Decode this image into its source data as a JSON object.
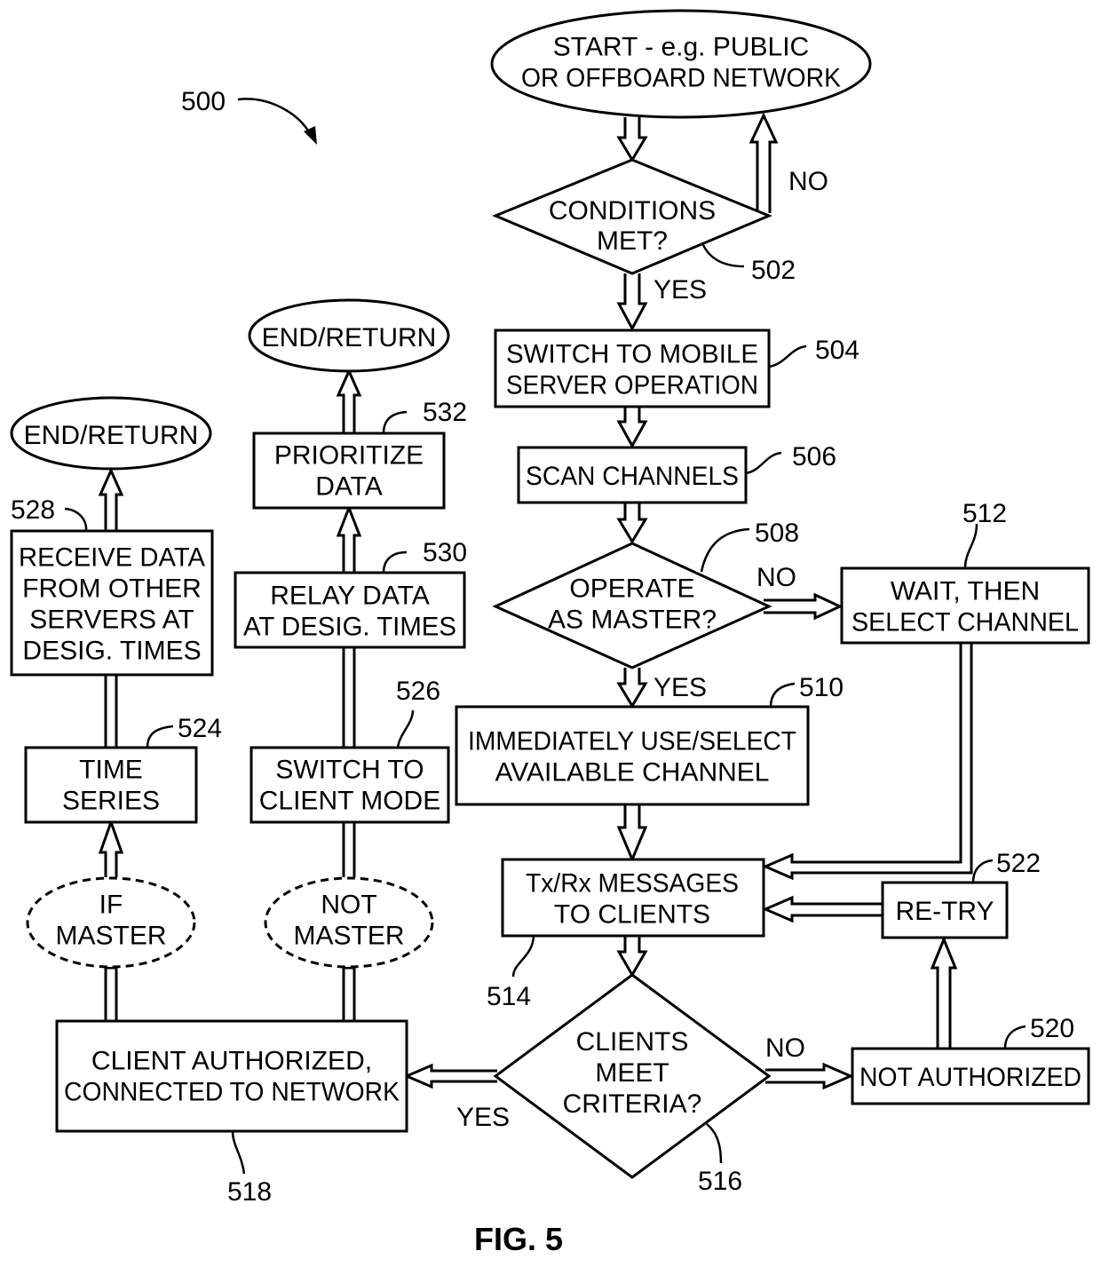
{
  "figure": {
    "title": "FIG. 5",
    "reference": "500"
  },
  "nodes": {
    "start": {
      "id": "start",
      "lines": [
        "START - e.g. PUBLIC",
        "OR OFFBOARD NETWORK"
      ],
      "ref": ""
    },
    "n502": {
      "id": "502",
      "lines": [
        "CONDITIONS",
        "MET?"
      ],
      "ref": "502"
    },
    "n504": {
      "id": "504",
      "lines": [
        "SWITCH TO MOBILE",
        "SERVER OPERATION"
      ],
      "ref": "504"
    },
    "n506": {
      "id": "506",
      "lines": [
        "SCAN CHANNELS"
      ],
      "ref": "506"
    },
    "n508": {
      "id": "508",
      "lines": [
        "OPERATE",
        "AS MASTER?"
      ],
      "ref": "508"
    },
    "n510": {
      "id": "510",
      "lines": [
        "IMMEDIATELY USE/SELECT",
        "AVAILABLE CHANNEL"
      ],
      "ref": "510"
    },
    "n512": {
      "id": "512",
      "lines": [
        "WAIT, THEN",
        "SELECT CHANNEL"
      ],
      "ref": "512"
    },
    "n514": {
      "id": "514",
      "lines": [
        "Tx/Rx MESSAGES",
        "TO CLIENTS"
      ],
      "ref": "514"
    },
    "n516": {
      "id": "516",
      "lines": [
        "CLIENTS",
        "MEET",
        "CRITERIA?"
      ],
      "ref": "516"
    },
    "n518": {
      "id": "518",
      "lines": [
        "CLIENT AUTHORIZED,",
        "CONNECTED TO NETWORK"
      ],
      "ref": "518"
    },
    "n520": {
      "id": "520",
      "lines": [
        "NOT AUTHORIZED"
      ],
      "ref": "520"
    },
    "n522": {
      "id": "522",
      "lines": [
        "RE-TRY"
      ],
      "ref": "522"
    },
    "n524": {
      "id": "524",
      "lines": [
        "TIME",
        "SERIES"
      ],
      "ref": "524"
    },
    "n526": {
      "id": "526",
      "lines": [
        "SWITCH TO",
        "CLIENT MODE"
      ],
      "ref": "526"
    },
    "n528": {
      "id": "528",
      "lines": [
        "RECEIVE DATA",
        "FROM OTHER",
        "SERVERS AT",
        "DESIG. TIMES"
      ],
      "ref": "528"
    },
    "n530": {
      "id": "530",
      "lines": [
        "RELAY DATA",
        "AT DESIG. TIMES"
      ],
      "ref": "530"
    },
    "n532": {
      "id": "532",
      "lines": [
        "PRIORITIZE",
        "DATA"
      ],
      "ref": "532"
    },
    "end_left": {
      "id": "end-left",
      "lines": [
        "END/RETURN"
      ],
      "ref": ""
    },
    "end_mid": {
      "id": "end-mid",
      "lines": [
        "END/RETURN"
      ],
      "ref": ""
    },
    "if_master": {
      "id": "if-master",
      "lines": [
        "IF",
        "MASTER"
      ],
      "ref": ""
    },
    "not_master": {
      "id": "not-master",
      "lines": [
        "NOT",
        "MASTER"
      ],
      "ref": ""
    }
  },
  "edge_labels": {
    "e502_no": "NO",
    "e502_yes": "YES",
    "e508_no": "NO",
    "e508_yes": "YES",
    "e516_no": "NO",
    "e516_yes": "YES"
  }
}
